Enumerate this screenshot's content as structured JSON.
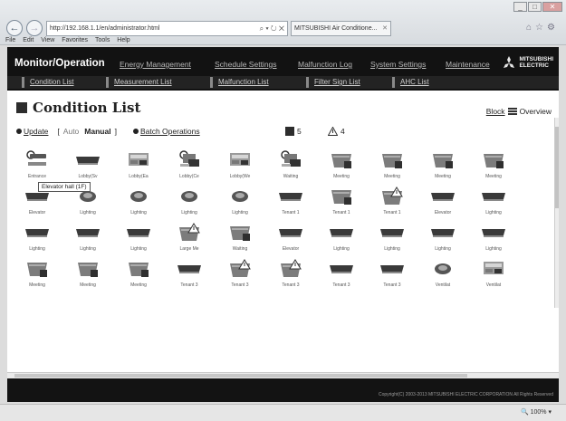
{
  "browser": {
    "url": "http://192.168.1.1/en/administrator.html",
    "address_tools": "⌕ ▾ ↻ ✕",
    "tab_title": "MITSUBISHI Air Conditione...",
    "menu": [
      "File",
      "Edit",
      "View",
      "Favorites",
      "Tools",
      "Help"
    ],
    "zoom": "100%"
  },
  "header": {
    "title": "Monitor/Operation",
    "nav": [
      "Energy Management",
      "Schedule Settings",
      "Malfunction Log",
      "System Settings",
      "Maintenance"
    ],
    "logo_line1": "MITSUBISHI",
    "logo_line2": "ELECTRIC"
  },
  "subnav": [
    "Condition List",
    "Measurement List",
    "Malfunction List",
    "Filter Sign List",
    "AHC List"
  ],
  "page": {
    "title": "Condition List",
    "block": "Block",
    "overview": "Overview",
    "update": "Update",
    "auto": "Auto",
    "manual": "Manual",
    "bracket_open": "[",
    "bracket_close": "]",
    "batch": "Batch Operations",
    "count_running": "5",
    "count_warning": "4",
    "tooltip": "Elevator hall (1F)"
  },
  "units": [
    {
      "label": "Entrance",
      "icon": "ceiling-cassette-icon"
    },
    {
      "label": "Lobby(Sv",
      "icon": "wall-mounted-icon"
    },
    {
      "label": "Lobby(Ea",
      "icon": "ventilation-icon"
    },
    {
      "label": "Lobby(Ce",
      "icon": "ducted-icon"
    },
    {
      "label": "Lobby(We",
      "icon": "ventilation-icon"
    },
    {
      "label": "Waiting",
      "icon": "ducted-icon"
    },
    {
      "label": "Meeting",
      "icon": "floor-unit-icon"
    },
    {
      "label": "Meeting",
      "icon": "floor-unit-icon"
    },
    {
      "label": "Meeting",
      "icon": "floor-unit-icon"
    },
    {
      "label": "Meeting",
      "icon": "floor-unit-icon"
    },
    {
      "label": "Elevator",
      "icon": "wall-mounted-icon"
    },
    {
      "label": "Lighting",
      "icon": "round-cassette-icon"
    },
    {
      "label": "Lighting",
      "icon": "round-cassette-icon"
    },
    {
      "label": "Lighting",
      "icon": "round-cassette-icon"
    },
    {
      "label": "Lighting",
      "icon": "round-cassette-icon"
    },
    {
      "label": "Tenant 1",
      "icon": "wall-mounted-icon"
    },
    {
      "label": "Tenant 1",
      "icon": "floor-unit-icon"
    },
    {
      "label": "Tenant 1",
      "icon": "floor-unit-warning-icon"
    },
    {
      "label": "Elevator",
      "icon": "wall-mounted-icon"
    },
    {
      "label": "Lighting",
      "icon": "wall-mounted-icon"
    },
    {
      "label": "Lighting",
      "icon": "wall-mounted-icon"
    },
    {
      "label": "Lighting",
      "icon": "wall-mounted-icon"
    },
    {
      "label": "Lighting",
      "icon": "wall-mounted-icon"
    },
    {
      "label": "Large Me",
      "icon": "floor-unit-warning-icon"
    },
    {
      "label": "Waiting",
      "icon": "floor-unit-icon"
    },
    {
      "label": "Elevator",
      "icon": "wall-mounted-icon"
    },
    {
      "label": "Lighting",
      "icon": "wall-mounted-icon"
    },
    {
      "label": "Lighting",
      "icon": "wall-mounted-icon"
    },
    {
      "label": "Lighting",
      "icon": "wall-mounted-icon"
    },
    {
      "label": "Lighting",
      "icon": "wall-mounted-icon"
    },
    {
      "label": "Meeting",
      "icon": "floor-unit-icon"
    },
    {
      "label": "Meeting",
      "icon": "floor-unit-icon"
    },
    {
      "label": "Meeting",
      "icon": "floor-unit-icon"
    },
    {
      "label": "Tenant 3",
      "icon": "wall-mounted-icon"
    },
    {
      "label": "Tenant 3",
      "icon": "floor-unit-warning-icon"
    },
    {
      "label": "Tenant 3",
      "icon": "floor-unit-warning-icon"
    },
    {
      "label": "Tenant 3",
      "icon": "wall-mounted-icon"
    },
    {
      "label": "Tenant 3",
      "icon": "wall-mounted-icon"
    },
    {
      "label": "Ventilat",
      "icon": "round-cassette-icon"
    },
    {
      "label": "Ventilat",
      "icon": "ventilation-icon"
    }
  ],
  "footer": {
    "copyright": "Copyright(C) 2003-2013 MITSUBISHI ELECTRIC CORPORATION All Rights Reserved"
  },
  "colors": {
    "header_bg": "#121212",
    "subnav_bg": "#232323",
    "content_bg": "#ffffff"
  }
}
